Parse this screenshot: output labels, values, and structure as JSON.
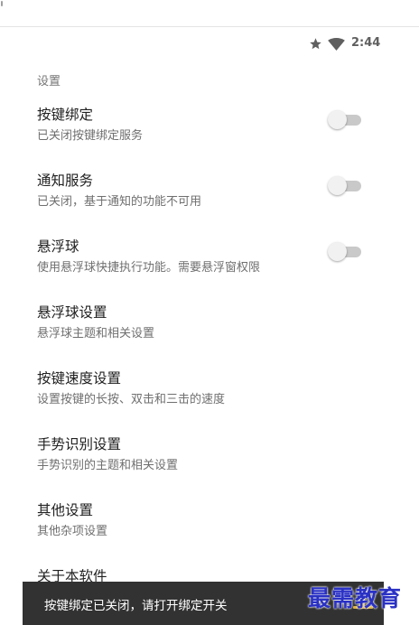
{
  "status_bar": {
    "time": "2:44",
    "icons": [
      "star-icon",
      "wifi-icon"
    ]
  },
  "section_header": "设置",
  "preferences": [
    {
      "title": "按键绑定",
      "summary": "已关闭按键绑定服务",
      "switch": "off"
    },
    {
      "title": "通知服务",
      "summary": "已关闭，基于通知的功能不可用",
      "switch": "off"
    },
    {
      "title": "悬浮球",
      "summary": "使用悬浮球快捷执行功能。需要悬浮窗权限",
      "switch": "off"
    },
    {
      "title": "悬浮球设置",
      "summary": "悬浮球主题和相关设置"
    },
    {
      "title": "按键速度设置",
      "summary": "设置按键的长按、双击和三击的速度"
    },
    {
      "title": "手势识别设置",
      "summary": "手势识别的主题和相关设置"
    },
    {
      "title": "其他设置",
      "summary": "其他杂项设置"
    },
    {
      "title": "关于本软件"
    }
  ],
  "snackbar": {
    "message": "按键绑定已关闭，请打开绑定开关"
  },
  "watermark": "最需教育",
  "colors": {
    "switch_track_off": "#c9c9c9",
    "switch_thumb_off": "#f1f1f1",
    "snackbar_bg": "#323232",
    "watermark": "#2a31c4"
  }
}
